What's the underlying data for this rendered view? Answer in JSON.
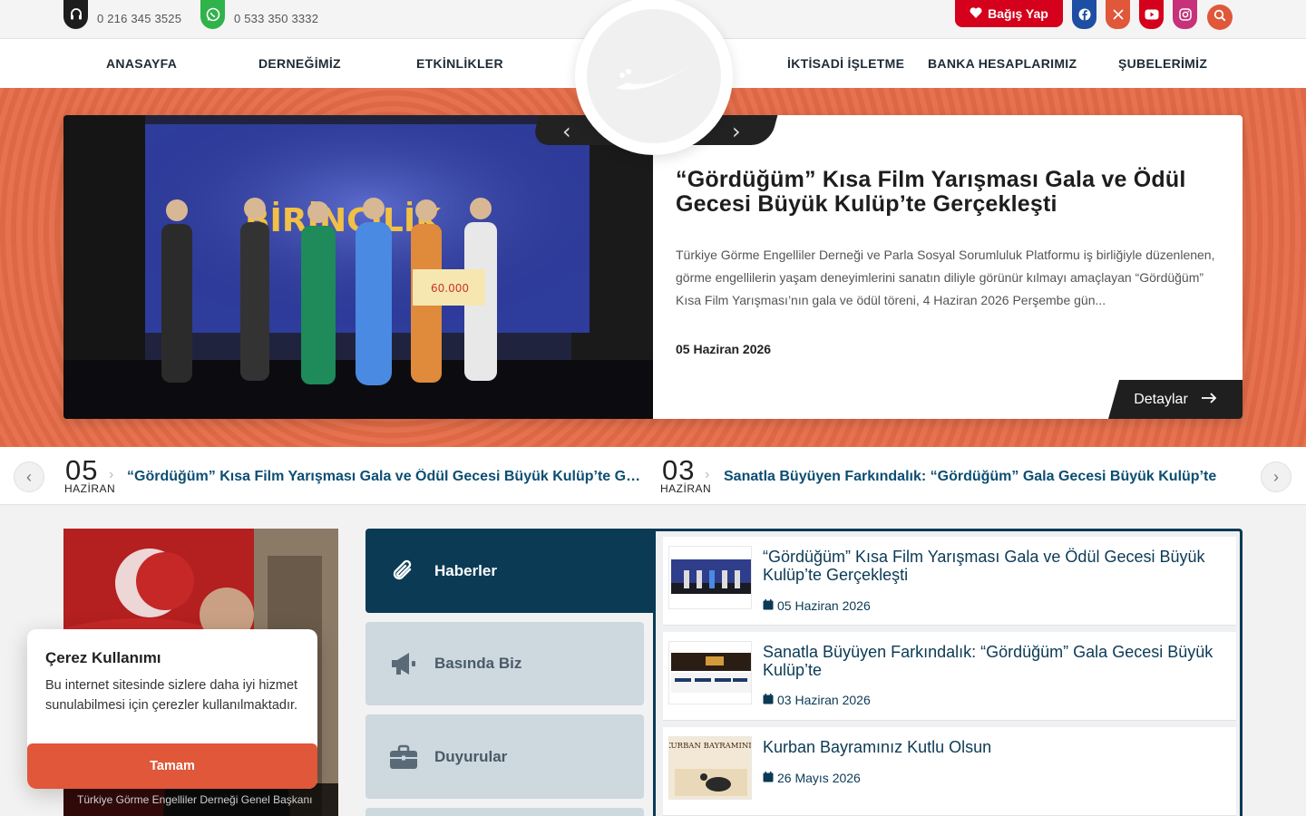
{
  "topbar": {
    "phone1": "0 216 345 3525",
    "phone2": "0 533 350 3332",
    "donate_label": "Bağış Yap",
    "social": [
      {
        "icon": "facebook-icon",
        "color": "#1d4ea3"
      },
      {
        "icon": "x-icon",
        "color": "#e0573a"
      },
      {
        "icon": "youtube-icon",
        "color": "#d5001c"
      },
      {
        "icon": "instagram-icon",
        "color": "#c7317a"
      }
    ]
  },
  "nav": {
    "items": [
      "ANASAYFA",
      "DERNEĞİMİZ",
      "ETKİNLİKLER",
      "İKTİSADİ İŞLETME",
      "BANKA HESAPLARIMIZ",
      "ŞUBELERİMİZ"
    ]
  },
  "hero": {
    "title": "“Gördüğüm” Kısa Film Yarışması Gala ve Ödül Gecesi Büyük Kulüp’te Gerçekleşti",
    "text": "Türkiye Görme Engelliler Derneği ve Parla Sosyal Sorumluluk Platformu iş birliğiyle düzenlenen, görme engellilerin yaşam deneyimlerini sanatın diliyle görünür kılmayı amaçlayan “Gördüğüm” Kısa Film Yarışması’nın gala ve ödül töreni, 4 Haziran 2026 Perşembe gün...",
    "date": "05 Haziran 2026",
    "details_label": "Detaylar",
    "photo_banner": "BİRİNCİLİK",
    "prize": "60.000"
  },
  "ticker": [
    {
      "day": "05",
      "month": "HAZİRAN",
      "title": "“Gördüğüm” Kısa Film Yarışması Gala ve Ödül Gecesi Büyük Kulüp’te Gerçekleşti"
    },
    {
      "day": "03",
      "month": "HAZİRAN",
      "title": "Sanatla Büyüyen Farkındalık: “Gördüğüm” Gala Gecesi Büyük Kulüp’te"
    }
  ],
  "president": {
    "caption": "Türkiye Görme Engelliler Derneği Genel Başkanı"
  },
  "tabs": [
    "Haberler",
    "Basında Biz",
    "Duyurular"
  ],
  "news": [
    {
      "title": "“Gördüğüm” Kısa Film Yarışması Gala ve Ödül Gecesi Büyük Kulüp’te Gerçekleşti",
      "date": "05 Haziran 2026"
    },
    {
      "title": "Sanatla Büyüyen Farkındalık: “Gördüğüm” Gala Gecesi Büyük Kulüp’te",
      "date": "03 Haziran 2026"
    },
    {
      "title": "Kurban Bayramınız Kutlu Olsun",
      "date": "26 Mayıs 2026",
      "thumb_text": "KURBAN BAYRAMINIZ"
    }
  ],
  "cookie": {
    "title": "Çerez Kullanımı",
    "text": "Bu internet sitesinde sizlere daha iyi hizmet sunulabilmesi için çerezler kullanılmaktadır.",
    "button": "Tamam"
  }
}
